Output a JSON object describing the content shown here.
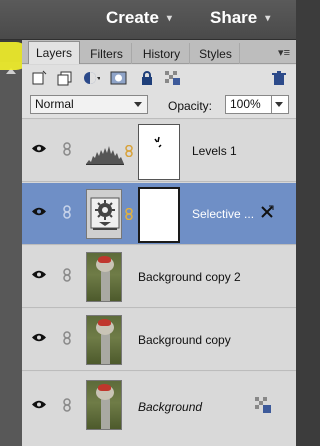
{
  "topbar": {
    "create_label": "Create",
    "share_label": "Share",
    "caret": "▾"
  },
  "tabs": [
    {
      "label": "Layers",
      "active": true
    },
    {
      "label": "Filters",
      "active": false
    },
    {
      "label": "History",
      "active": false
    },
    {
      "label": "Styles",
      "active": false
    }
  ],
  "panel_menu_icon": "▾≡",
  "toolbar": {
    "icons": [
      "new-layer-icon",
      "new-group-icon",
      "adjustment-layer-icon",
      "add-mask-icon",
      "lock-all-icon",
      "lock-transparency-icon",
      "trash-icon"
    ]
  },
  "blend": {
    "mode": "Normal",
    "opacity_label": "Opacity:",
    "opacity_value": "100%"
  },
  "layers": [
    {
      "name": "Levels 1",
      "type": "adjustment-levels",
      "selected": false,
      "italic": false
    },
    {
      "name": "Selective ...",
      "type": "adjustment-selective-color",
      "selected": true,
      "italic": false
    },
    {
      "name": "Background copy 2",
      "type": "image",
      "selected": false,
      "italic": false
    },
    {
      "name": "Background copy",
      "type": "image",
      "selected": false,
      "italic": false
    },
    {
      "name": "Background",
      "type": "image",
      "selected": false,
      "italic": true
    }
  ],
  "colors": {
    "panel_bg": "#d7d7d7",
    "selected_row": "#6f8fc6",
    "topbar": "#4f4f4f",
    "highlight": "#f4f22a"
  }
}
